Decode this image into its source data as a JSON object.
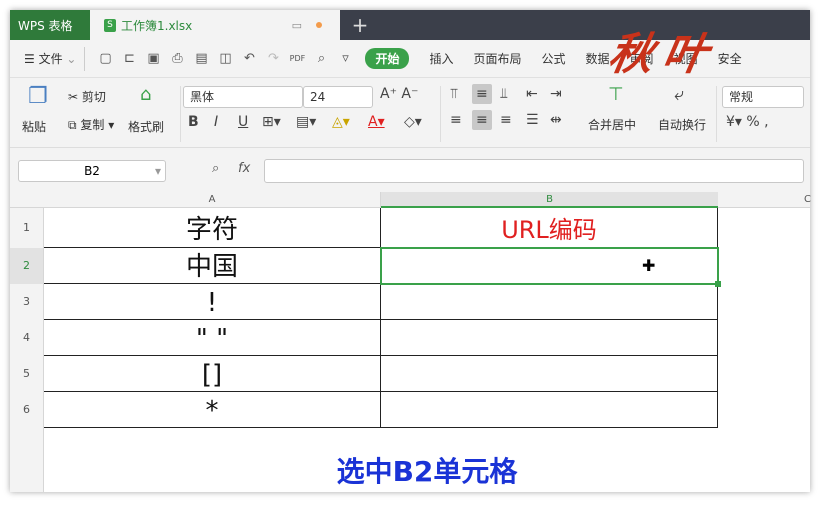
{
  "titlebar": {
    "app": "WPS 表格",
    "doc": "工作簿1.xlsx",
    "doc_icon": "S",
    "new_tab": "+"
  },
  "menubar": {
    "file": "文件",
    "start": "开始",
    "tabs": [
      "插入",
      "页面布局",
      "公式",
      "数据",
      "审阅",
      "视图",
      "安全"
    ]
  },
  "logo_text": "秋叶",
  "ribbon": {
    "paste": "粘贴",
    "cut": "剪切",
    "copy": "复制",
    "format_painter": "格式刷",
    "font": "黑体",
    "size": "24",
    "merge": "合并居中",
    "wrap": "自动换行",
    "number_format": "常规"
  },
  "formula": {
    "namebox": "B2",
    "fx": "fx",
    "value": ""
  },
  "sheet": {
    "columns": [
      "A",
      "B",
      "C"
    ],
    "rows": [
      "1",
      "2",
      "3",
      "4",
      "5",
      "6"
    ],
    "a": [
      "字符",
      "中国",
      "!",
      "\" \"",
      "[]",
      "*"
    ],
    "b1": "URL编码"
  },
  "caption": "选中B2单元格",
  "colors": {
    "green": "#3aa14a",
    "red": "#e02020",
    "blue": "#1a33d6"
  }
}
